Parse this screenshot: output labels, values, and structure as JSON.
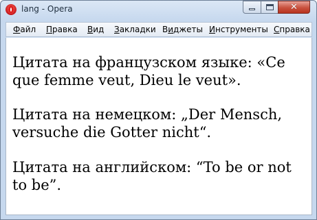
{
  "window": {
    "title": "lang - Opera",
    "close_glyph": "✕"
  },
  "menu": [
    {
      "label": "Файл",
      "access_key_index": 0
    },
    {
      "label": "Правка",
      "access_key_index": 0
    },
    {
      "label": "Вид",
      "access_key_index": 0
    },
    {
      "label": "Закладки",
      "access_key_index": 0
    },
    {
      "label": "Виджеты",
      "access_key_index": 1
    },
    {
      "label": "Инструменты",
      "access_key_index": 0
    },
    {
      "label": "Справка",
      "access_key_index": 0
    }
  ],
  "content": {
    "paragraphs": [
      "Цитата на французском языке: «Ce que femme veut, Dieu le veut».",
      "Цитата на немецком: „Der Mensch, versuche die Gotter nicht“.",
      "Цитата на английском: “To be or not to be”."
    ]
  }
}
